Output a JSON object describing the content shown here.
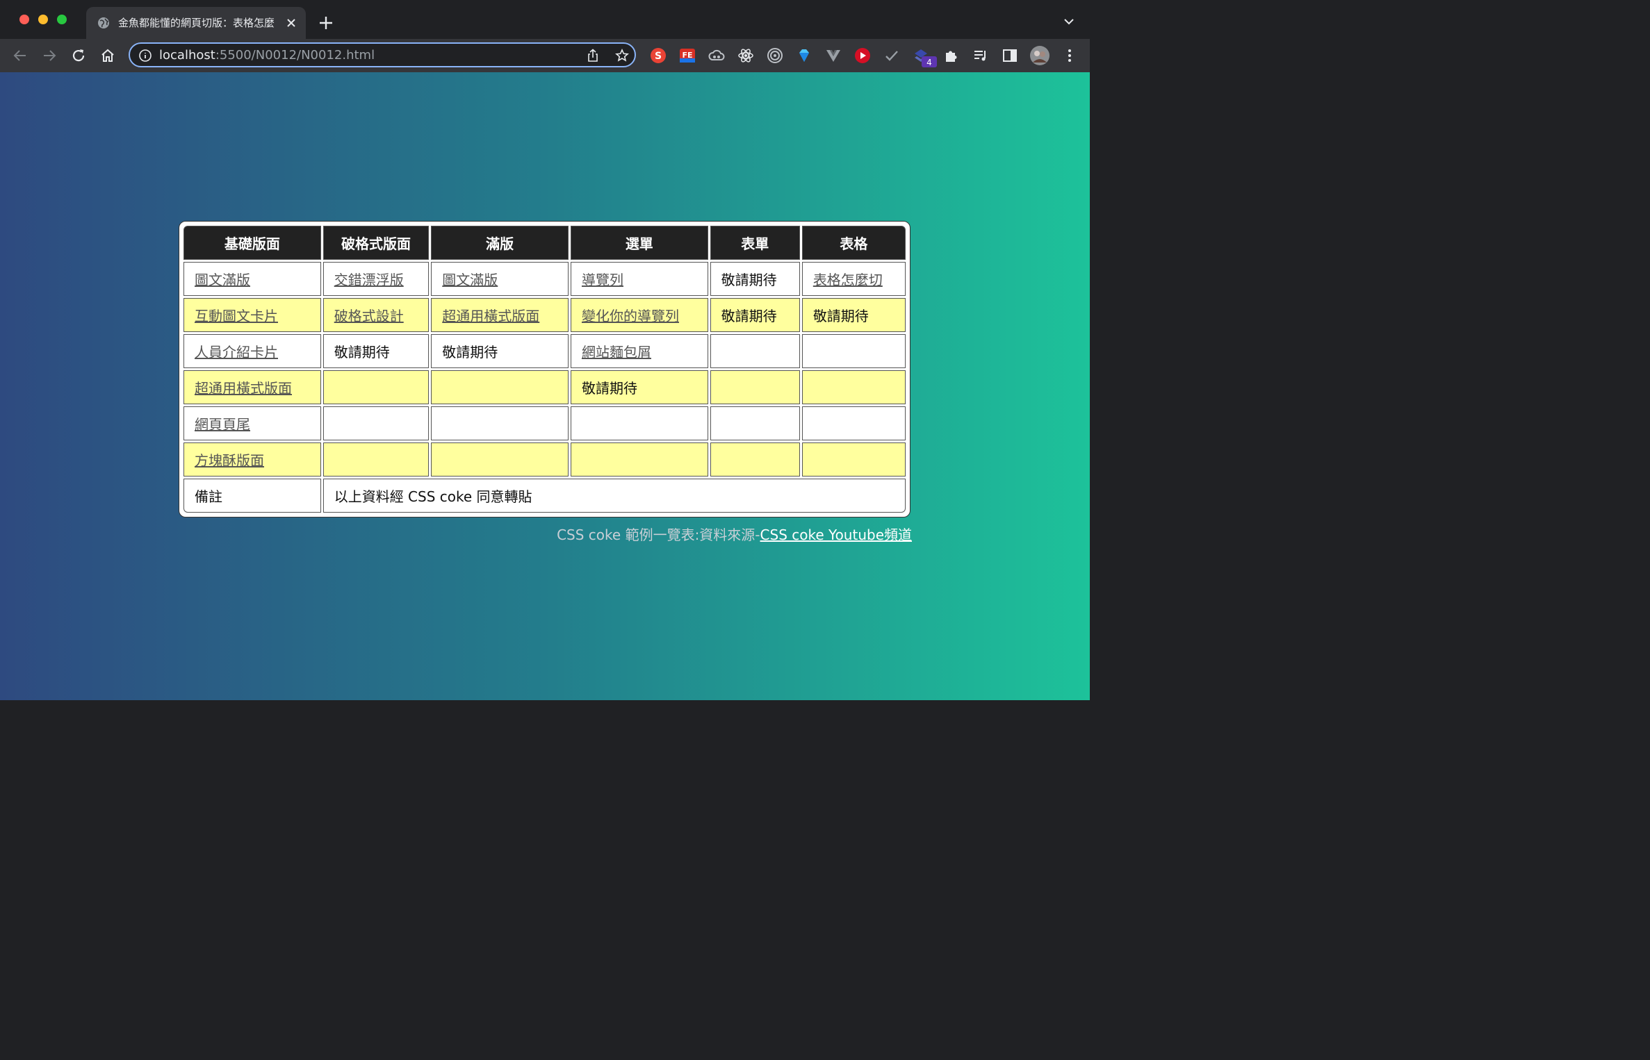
{
  "browser": {
    "tab_title": "金魚都能懂的網頁切版：表格怎麼",
    "url_host": "localhost",
    "url_path": ":5500/N0012/N0012.html",
    "extensions": [
      "s-extension-icon",
      "fe-extension-icon",
      "cloud-extension-icon",
      "react-extension-icon",
      "target-extension-icon",
      "gem-extension-icon",
      "vue-extension-icon",
      "play-extension-icon",
      "check-extension-icon",
      "layers-extension-icon",
      "puzzle-icon",
      "playlist-icon",
      "side-panel-icon",
      "profile-avatar"
    ],
    "extension_badge": "4",
    "accent_color": "#8ab4f8"
  },
  "table": {
    "headers": [
      "基礎版面",
      "破格式版面",
      "滿版",
      "選單",
      "表單",
      "表格"
    ],
    "rows": [
      {
        "style": "white",
        "cells": [
          {
            "text": "圖文滿版",
            "link": true
          },
          {
            "text": "交錯漂浮版",
            "link": true
          },
          {
            "text": "圖文滿版",
            "link": true
          },
          {
            "text": "導覽列",
            "link": true
          },
          {
            "text": "敬請期待",
            "link": false
          },
          {
            "text": "表格怎麼切",
            "link": true
          }
        ]
      },
      {
        "style": "yellow",
        "cells": [
          {
            "text": "互動圖文卡片",
            "link": true
          },
          {
            "text": "破格式設計",
            "link": true
          },
          {
            "text": "超通用橫式版面",
            "link": true
          },
          {
            "text": "變化你的導覽列",
            "link": true
          },
          {
            "text": "敬請期待",
            "link": false
          },
          {
            "text": "敬請期待",
            "link": false
          }
        ]
      },
      {
        "style": "white",
        "cells": [
          {
            "text": "人員介紹卡片",
            "link": true
          },
          {
            "text": "敬請期待",
            "link": false
          },
          {
            "text": "敬請期待",
            "link": false
          },
          {
            "text": "網站麵包屑",
            "link": true
          },
          {
            "text": "",
            "link": false
          },
          {
            "text": "",
            "link": false
          }
        ]
      },
      {
        "style": "yellow",
        "cells": [
          {
            "text": "超通用橫式版面",
            "link": true
          },
          {
            "text": "",
            "link": false
          },
          {
            "text": "",
            "link": false
          },
          {
            "text": "敬請期待",
            "link": false
          },
          {
            "text": "",
            "link": false
          },
          {
            "text": "",
            "link": false
          }
        ]
      },
      {
        "style": "white",
        "cells": [
          {
            "text": "網頁頁尾",
            "link": true
          },
          {
            "text": "",
            "link": false
          },
          {
            "text": "",
            "link": false
          },
          {
            "text": "",
            "link": false
          },
          {
            "text": "",
            "link": false
          },
          {
            "text": "",
            "link": false
          }
        ]
      },
      {
        "style": "yellow",
        "cells": [
          {
            "text": "方塊酥版面",
            "link": true
          },
          {
            "text": "",
            "link": false
          },
          {
            "text": "",
            "link": false
          },
          {
            "text": "",
            "link": false
          },
          {
            "text": "",
            "link": false
          },
          {
            "text": "",
            "link": false
          }
        ]
      }
    ],
    "note_label": "備註",
    "note_text": "以上資料經 CSS coke 同意轉貼",
    "row_colors": {
      "yellow": "#ffff9e",
      "white": "#ffffff",
      "header": "#222222"
    }
  },
  "caption": {
    "text": "CSS coke 範例一覽表:資料來源-",
    "link_text": "CSS coke Youtube頻道"
  },
  "background": {
    "gradient_start": "#2e4a80",
    "gradient_end": "#1dc29a"
  }
}
